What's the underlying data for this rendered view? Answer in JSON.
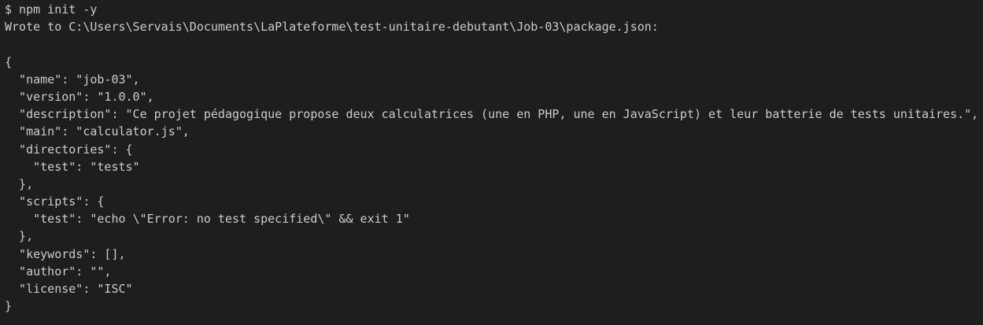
{
  "terminal": {
    "lines": [
      "$ npm init -y",
      "Wrote to C:\\Users\\Servais\\Documents\\LaPlateforme\\test-unitaire-debutant\\Job-03\\package.json:",
      "",
      "{",
      "  \"name\": \"job-03\",",
      "  \"version\": \"1.0.0\",",
      "  \"description\": \"Ce projet pédagogique propose deux calculatrices (une en PHP, une en JavaScript) et leur batterie de tests unitaires.\",",
      "  \"main\": \"calculator.js\",",
      "  \"directories\": {",
      "    \"test\": \"tests\"",
      "  },",
      "  \"scripts\": {",
      "    \"test\": \"echo \\\"Error: no test specified\\\" && exit 1\"",
      "  },",
      "  \"keywords\": [],",
      "  \"author\": \"\",",
      "  \"license\": \"ISC\"",
      "}"
    ]
  },
  "colors": {
    "background": "#1e1e1e",
    "text": "#cccccc",
    "prompt_green": "#23d18b"
  }
}
